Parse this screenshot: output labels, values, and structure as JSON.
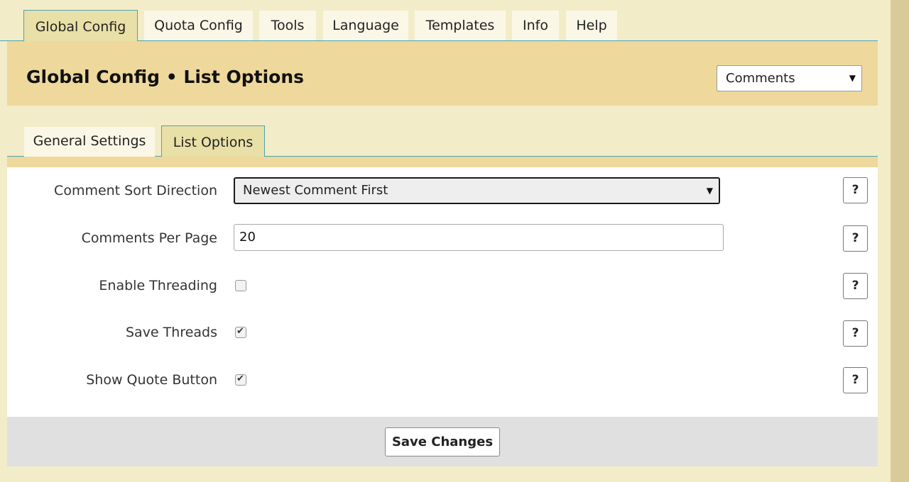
{
  "top_tabs": [
    {
      "label": "Global Config",
      "active": true
    },
    {
      "label": "Quota Config",
      "active": false
    },
    {
      "label": "Tools",
      "active": false
    },
    {
      "label": "Language",
      "active": false
    },
    {
      "label": "Templates",
      "active": false
    },
    {
      "label": "Info",
      "active": false
    },
    {
      "label": "Help",
      "active": false
    }
  ],
  "header": {
    "title": "Global Config • List Options",
    "section_select": {
      "value": "Comments",
      "caret": "▼"
    }
  },
  "sub_tabs": [
    {
      "label": "General Settings",
      "active": false
    },
    {
      "label": "List Options",
      "active": true
    }
  ],
  "form": {
    "fields": [
      {
        "label": "Comment Sort Direction",
        "type": "select",
        "value": "Newest Comment First",
        "caret": "▼"
      },
      {
        "label": "Comments Per Page",
        "type": "text",
        "value": "20"
      },
      {
        "label": "Enable Threading",
        "type": "checkbox",
        "checked": false
      },
      {
        "label": "Save Threads",
        "type": "checkbox",
        "checked": true
      },
      {
        "label": "Show Quote Button",
        "type": "checkbox",
        "checked": true
      }
    ],
    "help_label": "?",
    "check_glyph": "✔"
  },
  "footer": {
    "save_label": "Save Changes"
  },
  "colors": {
    "page_bg": "#f3ecc9",
    "header_band": "#eed89c",
    "active_tab": "#e8e0a6",
    "tab_border": "#4aa3b7",
    "footer_band": "#e0e0e0",
    "scroll_strip": "#d9cb99"
  }
}
